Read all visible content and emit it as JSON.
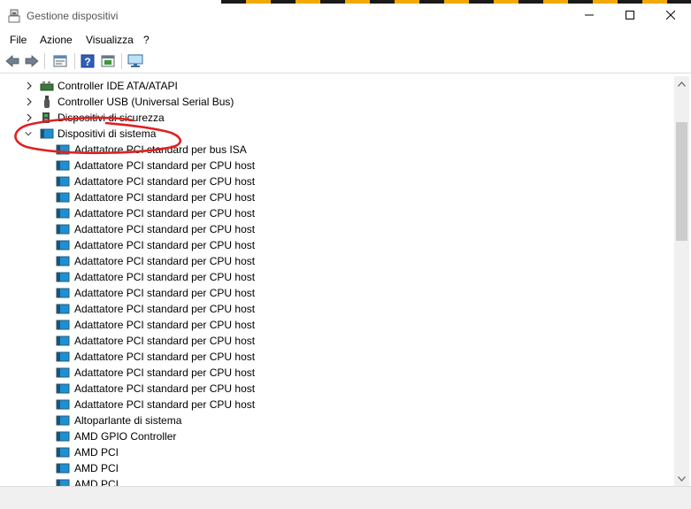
{
  "window": {
    "title": "Gestione dispositivi"
  },
  "menu": {
    "items": [
      "File",
      "Azione",
      "Visualizza",
      "?"
    ]
  },
  "toolbar": {
    "buttons": [
      "back-icon",
      "forward-icon",
      "properties-icon",
      "help-icon",
      "update-driver-icon",
      "scan-hardware-icon"
    ]
  },
  "tree": {
    "categories": [
      {
        "label": "Controller IDE ATA/ATAPI",
        "expanded": false,
        "icon": "ide-controller-icon"
      },
      {
        "label": "Controller USB (Universal Serial Bus)",
        "expanded": false,
        "icon": "usb-controller-icon"
      },
      {
        "label": "Dispositivi di sicurezza",
        "expanded": false,
        "icon": "security-device-icon"
      },
      {
        "label": "Dispositivi di sistema",
        "expanded": true,
        "icon": "system-device-icon"
      }
    ],
    "devices": [
      "Adattatore PCI standard per bus ISA",
      "Adattatore PCI standard per CPU host",
      "Adattatore PCI standard per CPU host",
      "Adattatore PCI standard per CPU host",
      "Adattatore PCI standard per CPU host",
      "Adattatore PCI standard per CPU host",
      "Adattatore PCI standard per CPU host",
      "Adattatore PCI standard per CPU host",
      "Adattatore PCI standard per CPU host",
      "Adattatore PCI standard per CPU host",
      "Adattatore PCI standard per CPU host",
      "Adattatore PCI standard per CPU host",
      "Adattatore PCI standard per CPU host",
      "Adattatore PCI standard per CPU host",
      "Adattatore PCI standard per CPU host",
      "Adattatore PCI standard per CPU host",
      "Adattatore PCI standard per CPU host",
      "Altoparlante di sistema",
      "AMD GPIO Controller",
      "AMD PCI",
      "AMD PCI",
      "AMD PCI"
    ]
  },
  "colors": {
    "annotation": "#e02020",
    "accent": "#1e90d0"
  }
}
